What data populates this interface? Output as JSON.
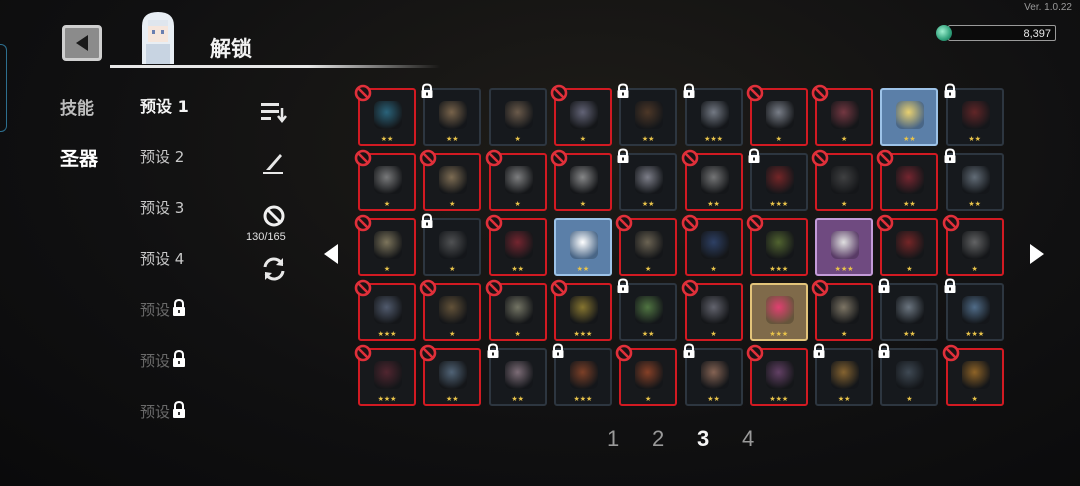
{
  "version": "Ver. 1.0.22",
  "header": {
    "title": "解锁"
  },
  "currency": {
    "amount": "8,397",
    "icon": "gem-icon"
  },
  "categories": {
    "skills": "技能",
    "relics": "圣器"
  },
  "presets": [
    "预设 1",
    "预设 2",
    "预设 3",
    "预设 4",
    "预设",
    "预设",
    "预设"
  ],
  "toolbar": {
    "count": "130/165"
  },
  "pagination": [
    "1",
    "2",
    "3",
    "4"
  ],
  "cells": [
    {
      "s": "banned",
      "stars": "★★",
      "c": "#3aa0c8"
    },
    {
      "s": "locked",
      "stars": "★★",
      "c": "#c8a070"
    },
    {
      "s": "plain",
      "stars": "★",
      "c": "#b09070"
    },
    {
      "s": "banned",
      "stars": "★",
      "c": "#a0a0c0"
    },
    {
      "s": "locked",
      "stars": "★★",
      "c": "#7a5030"
    },
    {
      "s": "locked",
      "stars": "★★★",
      "c": "#c0c8d8"
    },
    {
      "s": "banned",
      "stars": "★",
      "c": "#c8d0e0"
    },
    {
      "s": "banned",
      "stars": "★",
      "c": "#c05060"
    },
    {
      "s": "blue",
      "stars": "★★",
      "c": "#e8d070"
    },
    {
      "s": "locked",
      "stars": "★★",
      "c": "#a03030"
    },
    {
      "s": "banned",
      "stars": "★",
      "c": "#c8c8c8"
    },
    {
      "s": "banned",
      "stars": "★",
      "c": "#d0b080"
    },
    {
      "s": "banned",
      "stars": "★",
      "c": "#d0d0d0"
    },
    {
      "s": "banned",
      "stars": "★",
      "c": "#e0e0e0"
    },
    {
      "s": "locked",
      "stars": "★★",
      "c": "#d0d0e0"
    },
    {
      "s": "banned",
      "stars": "★★",
      "c": "#c0c0c0"
    },
    {
      "s": "locked",
      "stars": "★★★",
      "c": "#c03030"
    },
    {
      "s": "banned",
      "stars": "★",
      "c": "#606060"
    },
    {
      "s": "banned",
      "stars": "★★",
      "c": "#c03040"
    },
    {
      "s": "locked",
      "stars": "★★",
      "c": "#a0b0c0"
    },
    {
      "s": "banned",
      "stars": "★",
      "c": "#d0c090"
    },
    {
      "s": "locked",
      "stars": "★",
      "c": "#808080"
    },
    {
      "s": "banned",
      "stars": "★★",
      "c": "#c03040"
    },
    {
      "s": "blue",
      "stars": "★★",
      "c": "#ffffff"
    },
    {
      "s": "banned",
      "stars": "★",
      "c": "#b0a080"
    },
    {
      "s": "banned",
      "stars": "★",
      "c": "#4060a0"
    },
    {
      "s": "banned",
      "stars": "★★★",
      "c": "#80a040"
    },
    {
      "s": "purple",
      "stars": "★★★",
      "c": "#e0e0e0"
    },
    {
      "s": "banned",
      "stars": "★",
      "c": "#c03030"
    },
    {
      "s": "banned",
      "stars": "★",
      "c": "#a0a0a0"
    },
    {
      "s": "banned",
      "stars": "★★★",
      "c": "#8090b0"
    },
    {
      "s": "banned",
      "stars": "★",
      "c": "#a08050"
    },
    {
      "s": "banned",
      "stars": "★",
      "c": "#c0c0a0"
    },
    {
      "s": "banned",
      "stars": "★★★",
      "c": "#e0c040"
    },
    {
      "s": "locked",
      "stars": "★★",
      "c": "#80c060"
    },
    {
      "s": "banned",
      "stars": "★",
      "c": "#a0a0b0"
    },
    {
      "s": "gold",
      "stars": "★★★",
      "c": "#e04070"
    },
    {
      "s": "banned",
      "stars": "★",
      "c": "#d0c0a0"
    },
    {
      "s": "locked",
      "stars": "★★",
      "c": "#b0c0d0"
    },
    {
      "s": "locked",
      "stars": "★★★",
      "c": "#80b0e0"
    },
    {
      "s": "banned",
      "stars": "★★★",
      "c": "#803040"
    },
    {
      "s": "banned",
      "stars": "★★",
      "c": "#80a0c0"
    },
    {
      "s": "locked",
      "stars": "★★",
      "c": "#d0b0c0"
    },
    {
      "s": "locked",
      "stars": "★★★",
      "c": "#d06030"
    },
    {
      "s": "banned",
      "stars": "★",
      "c": "#e06030"
    },
    {
      "s": "locked",
      "stars": "★★",
      "c": "#e0a080"
    },
    {
      "s": "banned",
      "stars": "★★★",
      "c": "#a060a0"
    },
    {
      "s": "locked",
      "stars": "★★",
      "c": "#e0a040"
    },
    {
      "s": "locked",
      "stars": "★",
      "c": "#607080"
    },
    {
      "s": "banned",
      "stars": "★",
      "c": "#f0a030"
    }
  ]
}
